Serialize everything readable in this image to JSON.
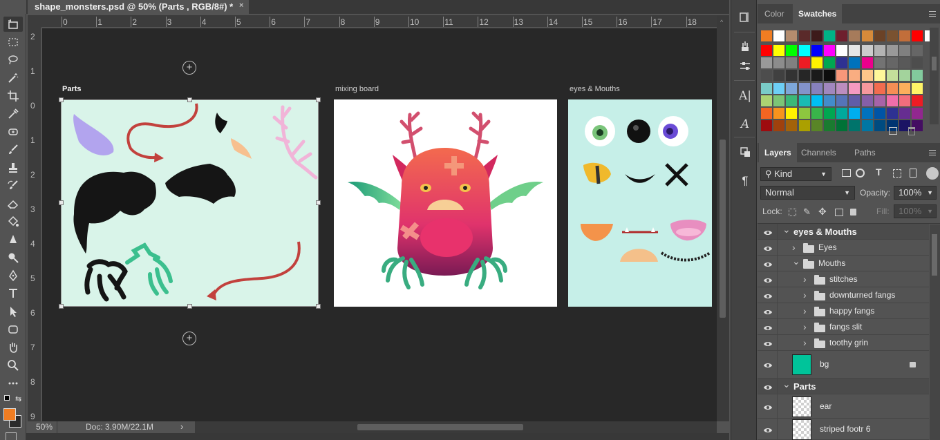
{
  "document": {
    "tab_title": "shape_monsters.psd @ 50% (Parts , RGB/8#) *",
    "close_glyph": "×"
  },
  "rulers": {
    "top_ticks": [
      "0",
      "1",
      "2",
      "3",
      "4",
      "5",
      "6",
      "7",
      "8",
      "9",
      "10",
      "11",
      "12",
      "13",
      "14",
      "15",
      "16",
      "17",
      "18"
    ],
    "left_ticks": [
      "2",
      "1",
      "0",
      "1",
      "2",
      "3",
      "4",
      "5",
      "6",
      "7",
      "8",
      "9"
    ]
  },
  "artboards": [
    {
      "label": "Parts",
      "bg": "#d9f4e9"
    },
    {
      "label": "mixing board",
      "bg": "#ffffff"
    },
    {
      "label": "eyes & Mouths",
      "bg": "#c6efe8"
    }
  ],
  "canvas": {
    "add_artboard_glyph": "+"
  },
  "status": {
    "zoom": "50%",
    "doc_size": "Doc: 3.90M/22.1M",
    "arrow": "›"
  },
  "tools": {
    "icons": [
      "artboard-icon",
      "marquee-icon",
      "lasso-icon",
      "magic-wand-icon",
      "crop-icon",
      "eyedropper-icon",
      "healing-brush-icon",
      "brush-icon",
      "clone-stamp-icon",
      "history-brush-icon",
      "eraser-icon",
      "paint-bucket-icon",
      "blur-icon",
      "dodge-icon",
      "pen-icon",
      "type-icon",
      "path-selection-icon",
      "rectangle-icon",
      "hand-icon",
      "zoom-icon",
      "more-icon"
    ],
    "foreground_color": "#f07d22",
    "background_color": "#2a2a2a"
  },
  "icon_strip": {
    "icons": [
      "history-icon",
      "brush-settings-icon",
      "adjustments-icon",
      "character-icon",
      "character-styles-icon",
      "paragraph-styles-icon",
      "paragraph-icon"
    ]
  },
  "color_panel": {
    "tabs": [
      "Color",
      "Swatches"
    ],
    "active_tab": "Swatches",
    "swatch_rows": [
      [
        "#f07d22",
        "#ffffff",
        "#b48c6e",
        "#5a2a2a",
        "#3d1a1a",
        "#00b386",
        "#6e1f2d",
        "#a67b5b",
        "#d68a3a",
        "#6b4226",
        "#7a5230",
        "#c26e3a",
        "#ff0000",
        "#ffffff"
      ],
      [
        "#ff0000",
        "#ffff00",
        "#00ff00",
        "#00ffff",
        "#0000ff",
        "#ff00ff",
        "#ffffff",
        "#e6e6e6",
        "#cccccc",
        "#b3b3b3",
        "#999999",
        "#808080",
        "#666666"
      ],
      [
        "#999999",
        "#8c8c8c",
        "#808080",
        "#ed1c24",
        "#fff200",
        "#00a651",
        "#2e3192",
        "#0072bc",
        "#ec008c",
        "#737373",
        "#666666",
        "#595959",
        "#4d4d4d"
      ],
      [
        "#4d4d4d",
        "#404040",
        "#333333",
        "#262626",
        "#1a1a1a",
        "#0d0d0d",
        "#f7977a",
        "#f9ad81",
        "#fdc68a",
        "#fff79a",
        "#c4df9b",
        "#a3d39c",
        "#82ca9d"
      ],
      [
        "#7accc8",
        "#6dcff6",
        "#7da7d9",
        "#8393ca",
        "#8781bd",
        "#a187be",
        "#bc8dbf",
        "#f49ac1",
        "#f6989d",
        "#f26c4f",
        "#f68e55",
        "#fbaf5c",
        "#fff467"
      ],
      [
        "#acd372",
        "#7cc576",
        "#3bb878",
        "#1abbb4",
        "#00bff3",
        "#438ccb",
        "#5574b9",
        "#605ca8",
        "#855fa8",
        "#a763a8",
        "#f06eaa",
        "#f26d7d",
        "#ed1c24"
      ],
      [
        "#f26522",
        "#f7941d",
        "#fff200",
        "#8dc63f",
        "#39b54a",
        "#00a651",
        "#00a99d",
        "#00aeef",
        "#0072bc",
        "#0054a6",
        "#2e3192",
        "#662d91",
        "#92278f"
      ],
      [
        "#9e0b0f",
        "#a0410d",
        "#a36209",
        "#aba000",
        "#598527",
        "#1a7b30",
        "#007236",
        "#00746b",
        "#0076a3",
        "#004b80",
        "#003471",
        "#1b1464",
        "#440e62"
      ]
    ]
  },
  "layers_panel": {
    "tabs": [
      "Layers",
      "Channels",
      "Paths"
    ],
    "active_tab": "Layers",
    "filter_label": "Kind",
    "blend_mode": "Normal",
    "opacity_label": "Opacity:",
    "opacity_value": "100%",
    "lock_label": "Lock:",
    "fill_label": "Fill:",
    "fill_value": "100%",
    "layers": [
      {
        "name": "eyes & Mouths",
        "kind": "artboard",
        "expanded": true
      },
      {
        "name": "Eyes",
        "kind": "group",
        "expanded": false
      },
      {
        "name": "Mouths",
        "kind": "group",
        "expanded": true
      },
      {
        "name": "stitches",
        "kind": "group",
        "expanded": false
      },
      {
        "name": "downturned fangs",
        "kind": "group",
        "expanded": false
      },
      {
        "name": "happy fangs",
        "kind": "group",
        "expanded": false
      },
      {
        "name": "fangs slit",
        "kind": "group",
        "expanded": false
      },
      {
        "name": "toothy grin",
        "kind": "group",
        "expanded": false
      },
      {
        "name": "bg",
        "kind": "layer",
        "thumb_color": "#00c49a",
        "locked": true
      },
      {
        "name": "Parts",
        "kind": "artboard",
        "expanded": true
      },
      {
        "name": "ear",
        "kind": "layer"
      },
      {
        "name": "striped footr 6",
        "kind": "layer"
      }
    ]
  }
}
